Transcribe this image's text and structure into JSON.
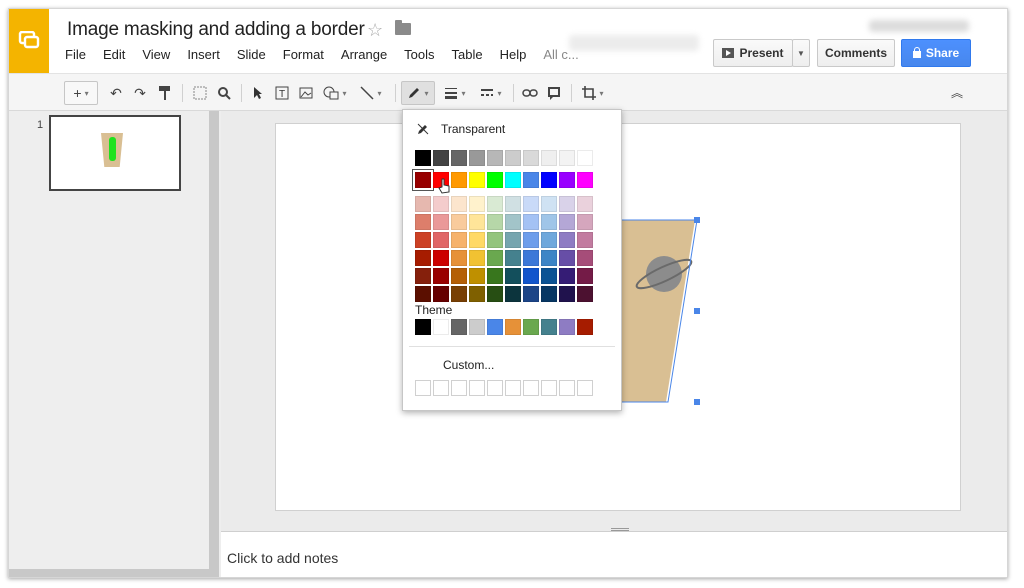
{
  "app": {
    "title": "Image masking and adding a border"
  },
  "menu": [
    "File",
    "Edit",
    "View",
    "Insert",
    "Slide",
    "Format",
    "Arrange",
    "Tools",
    "Table",
    "Help",
    "All c..."
  ],
  "buttons": {
    "present": "Present",
    "comments": "Comments",
    "share": "Share"
  },
  "filmstrip": {
    "slide_number": "1"
  },
  "notes": {
    "placeholder": "Click to add notes"
  },
  "palette": {
    "transparent_label": "Transparent",
    "theme_label": "Theme",
    "custom_label": "Custom...",
    "grays": [
      "#000000",
      "#434343",
      "#666666",
      "#999999",
      "#b7b7b7",
      "#cccccc",
      "#d9d9d9",
      "#efefef",
      "#f3f3f3",
      "#ffffff"
    ],
    "brights": [
      "#980000",
      "#ff0000",
      "#ff9900",
      "#ffff00",
      "#00ff00",
      "#00ffff",
      "#4a86e8",
      "#0000ff",
      "#9900ff",
      "#ff00ff"
    ],
    "tints": [
      [
        "#e6b8af",
        "#f4cccc",
        "#fce5cd",
        "#fff2cc",
        "#d9ead3",
        "#d0e0e3",
        "#c9daf8",
        "#cfe2f3",
        "#d9d2e9",
        "#ead1dc"
      ],
      [
        "#dd7e6b",
        "#ea9999",
        "#f9cb9c",
        "#ffe599",
        "#b6d7a8",
        "#a2c4c9",
        "#a4c2f4",
        "#9fc5e8",
        "#b4a7d6",
        "#d5a6bd"
      ],
      [
        "#cc4125",
        "#e06666",
        "#f6b26b",
        "#ffd966",
        "#93c47d",
        "#76a5af",
        "#6d9eeb",
        "#6fa8dc",
        "#8e7cc3",
        "#c27ba0"
      ],
      [
        "#a61c00",
        "#cc0000",
        "#e69138",
        "#f1c232",
        "#6aa84f",
        "#45818e",
        "#3c78d8",
        "#3d85c6",
        "#674ea7",
        "#a64d79"
      ],
      [
        "#85200c",
        "#990000",
        "#b45f06",
        "#bf9000",
        "#38761d",
        "#134f5c",
        "#1155cc",
        "#0b5394",
        "#351c75",
        "#741b47"
      ],
      [
        "#5b0f00",
        "#660000",
        "#783f04",
        "#7f6000",
        "#274e13",
        "#0c343d",
        "#1c4587",
        "#073763",
        "#20124d",
        "#4c1130"
      ]
    ],
    "theme": [
      "#000000",
      "#ffffff",
      "#666666",
      "#cccccc",
      "#4a86e8",
      "#e69138",
      "#6aa84f",
      "#45818e",
      "#8e7cc3",
      "#a61c00"
    ],
    "selected": "#980000"
  },
  "colors": {
    "logo": "#f4b400",
    "share": "#4d90fe",
    "selection": "#4a86e8",
    "alien": "#1ee21e",
    "image_bg": "#d9bf93",
    "planet": "#8c8c8c"
  }
}
